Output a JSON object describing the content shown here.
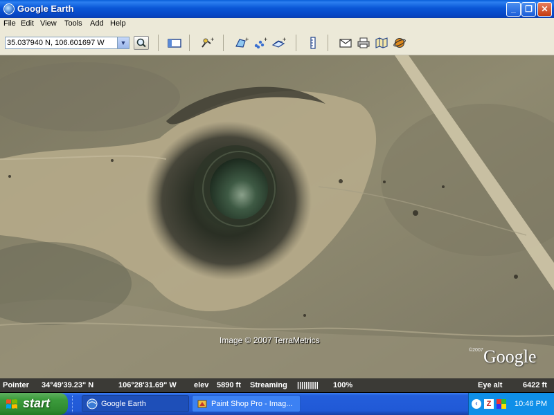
{
  "window": {
    "title": "Google Earth"
  },
  "menu": [
    "File",
    "Edit",
    "View",
    "Tools",
    "Add",
    "Help"
  ],
  "toolbar": {
    "search_value": "35.037940 N, 106.601697 W"
  },
  "map": {
    "attribution": "Image © 2007 TerraMetrics",
    "logo": "Google",
    "logo_copyright": "©2007"
  },
  "status": {
    "pointer_label": "Pointer",
    "lat": "34°49'39.23\" N",
    "lon": "106°28'31.69\" W",
    "elev_label": "elev",
    "elev": "5890 ft",
    "streaming_label": "Streaming",
    "streaming_bars": "||||||||||",
    "streaming_pct": "100%",
    "eye_alt_label": "Eye alt",
    "eye_alt": "6422 ft"
  },
  "taskbar": {
    "start_label": "start",
    "tasks": [
      {
        "label": "Google Earth",
        "icon": "google-earth-icon",
        "active": true
      },
      {
        "label": "Paint Shop Pro - Imag...",
        "icon": "paint-shop-pro-icon",
        "active": false
      }
    ],
    "tray": {
      "clock": "10:46 PM"
    }
  }
}
